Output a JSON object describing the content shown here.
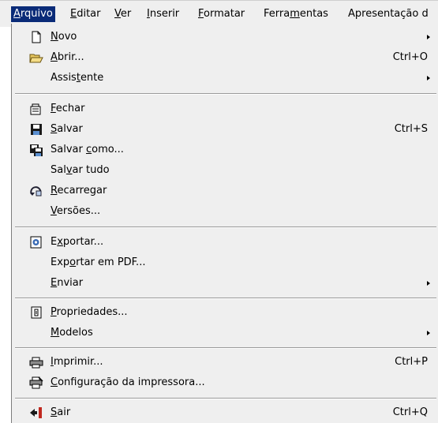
{
  "menubar": {
    "items": [
      {
        "label": "Arquivo",
        "mnemonic": "A",
        "rest": "rquivo",
        "active": true
      },
      {
        "label": "Editar",
        "mnemonic": "E",
        "rest": "ditar"
      },
      {
        "label": "Ver",
        "mnemonic": "V",
        "rest": "er"
      },
      {
        "label": "Inserir",
        "mnemonic": "I",
        "rest": "nserir"
      },
      {
        "label": "Formatar",
        "mnemonic": "F",
        "rest": "ormatar"
      },
      {
        "label": "Ferramentas",
        "pre": "Ferra",
        "mnemonic": "m",
        "rest": "entas"
      },
      {
        "label": "Apresentação d",
        "plain": "Apresentação d"
      }
    ]
  },
  "menu": {
    "items": [
      {
        "pre": "",
        "mn": "N",
        "post": "ovo",
        "shortcut": "",
        "submenu": true,
        "icon": "new-document-icon"
      },
      {
        "pre": "",
        "mn": "A",
        "post": "brir...",
        "shortcut": "Ctrl+O",
        "icon": "open-folder-icon"
      },
      {
        "pre": "Assis",
        "mn": "t",
        "post": "ente",
        "shortcut": "",
        "submenu": true
      },
      {
        "pre": "",
        "mn": "F",
        "post": "echar",
        "shortcut": "",
        "icon": "close-document-icon"
      },
      {
        "pre": "",
        "mn": "S",
        "post": "alvar",
        "shortcut": "Ctrl+S",
        "icon": "save-icon"
      },
      {
        "pre": "Salvar ",
        "mn": "c",
        "post": "omo...",
        "shortcut": "",
        "icon": "save-as-icon"
      },
      {
        "pre": "Sal",
        "mn": "v",
        "post": "ar tudo",
        "shortcut": ""
      },
      {
        "pre": "",
        "mn": "R",
        "post": "ecarregar",
        "shortcut": "",
        "icon": "reload-icon"
      },
      {
        "pre": "",
        "mn": "V",
        "post": "ersões...",
        "shortcut": ""
      },
      {
        "pre": "E",
        "mn": "x",
        "post": "portar...",
        "shortcut": "",
        "icon": "export-icon"
      },
      {
        "pre": "Exp",
        "mn": "o",
        "post": "rtar em PDF...",
        "shortcut": ""
      },
      {
        "pre": "",
        "mn": "E",
        "post": "nviar",
        "shortcut": "",
        "submenu": true
      },
      {
        "pre": "",
        "mn": "P",
        "post": "ropriedades...",
        "shortcut": "",
        "icon": "properties-icon"
      },
      {
        "pre": "",
        "mn": "M",
        "post": "odelos",
        "shortcut": "",
        "submenu": true
      },
      {
        "pre": "",
        "mn": "I",
        "post": "mprimir...",
        "shortcut": "Ctrl+P",
        "icon": "printer-icon"
      },
      {
        "pre": "",
        "mn": "C",
        "post": "onfiguração da impressora...",
        "shortcut": "",
        "icon": "printer-setup-icon"
      },
      {
        "pre": "",
        "mn": "S",
        "post": "air",
        "shortcut": "Ctrl+Q",
        "icon": "exit-icon"
      }
    ]
  }
}
